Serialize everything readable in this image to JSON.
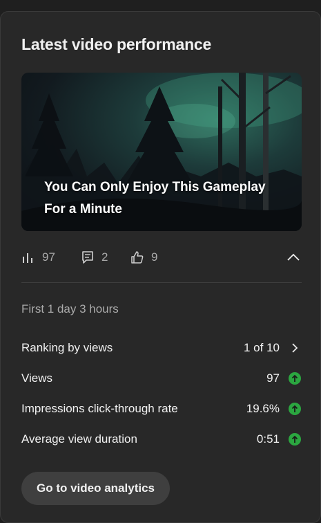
{
  "card": {
    "title": "Latest video performance"
  },
  "video": {
    "title_line1": "You Can Only Enjoy This Gameplay",
    "title_line2": "For a Minute"
  },
  "stats": {
    "views": "97",
    "comments": "2",
    "likes": "9"
  },
  "period": "First 1 day 3 hours",
  "metrics": [
    {
      "label": "Ranking by views",
      "value": "1 of 10",
      "indicator": "chevron-right-icon"
    },
    {
      "label": "Views",
      "value": "97",
      "indicator": "arrow-up-icon"
    },
    {
      "label": "Impressions click-through rate",
      "value": "19.6%",
      "indicator": "arrow-up-icon"
    },
    {
      "label": "Average view duration",
      "value": "0:51",
      "indicator": "arrow-up-icon"
    }
  ],
  "actions": {
    "go_to_analytics": "Go to video analytics"
  },
  "colors": {
    "background": "#282828",
    "trend_up": "#2ba640",
    "secondary_text": "#aaaaaa"
  }
}
